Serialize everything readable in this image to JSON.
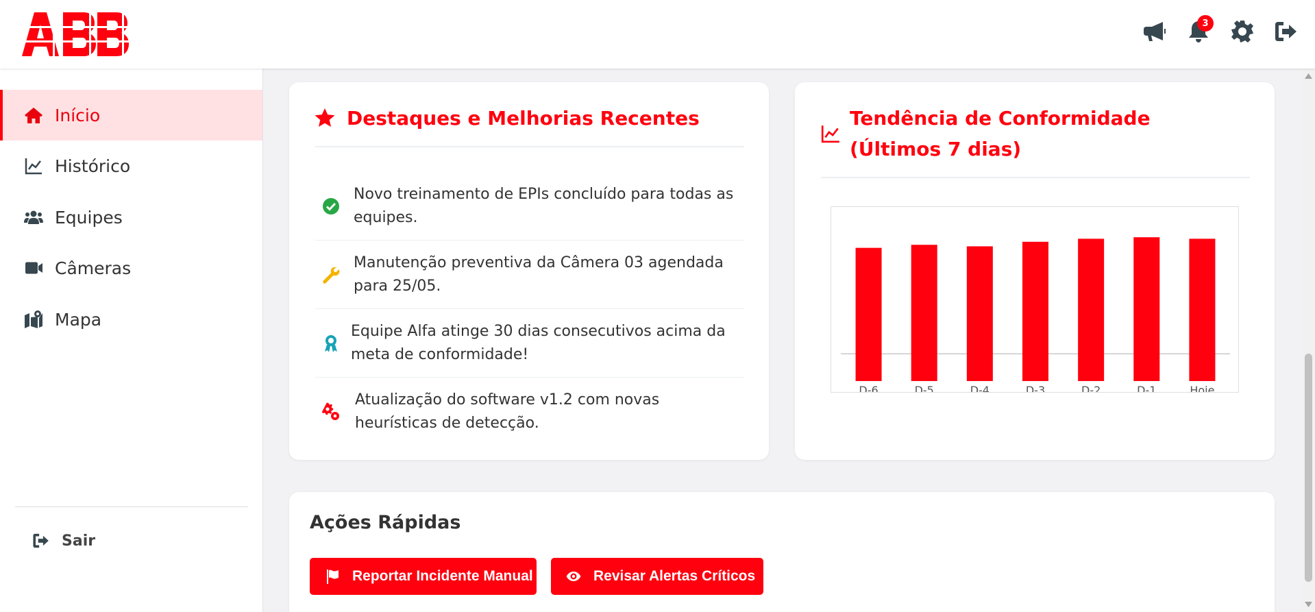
{
  "header": {
    "logo_text": "ABB",
    "notification_count": "3",
    "icons": [
      "megaphone-icon",
      "bell-icon",
      "gear-icon",
      "sign-out-icon"
    ]
  },
  "sidebar": {
    "items": [
      {
        "label": "Início",
        "icon": "home-icon",
        "active": true
      },
      {
        "label": "Histórico",
        "icon": "chart-line-icon",
        "active": false
      },
      {
        "label": "Equipes",
        "icon": "users-icon",
        "active": false
      },
      {
        "label": "Câmeras",
        "icon": "video-icon",
        "active": false
      },
      {
        "label": "Mapa",
        "icon": "map-icon",
        "active": false
      }
    ],
    "logout_label": "Sair"
  },
  "highlights": {
    "title": "Destaques e Melhorias Recentes",
    "items": [
      {
        "text": "Novo treinamento de EPIs concluído para todas as equipes.",
        "icon": "check-circle-icon"
      },
      {
        "text": "Manutenção preventiva da Câmera 03 agendada para 25/05.",
        "icon": "wrench-icon"
      },
      {
        "text": "Equipe Alfa atinge 30 dias consecutivos acima da meta de conformidade!",
        "icon": "award-icon"
      },
      {
        "text": "Atualização do software v1.2 com novas heurísticas de detecção.",
        "icon": "cogs-icon"
      }
    ]
  },
  "trend": {
    "title": "Tendência de Conformidade (Últimos 7 dias)"
  },
  "chart_data": {
    "type": "bar",
    "categories": [
      "D-6",
      "D-5",
      "D-4",
      "D-3",
      "D-2",
      "D-1",
      "Hoje"
    ],
    "values": [
      88,
      90,
      89,
      92,
      94,
      95,
      94
    ],
    "ylim": [
      0,
      115
    ],
    "reference_line": 18,
    "title": "",
    "xlabel": "",
    "ylabel": "",
    "grid": false,
    "color": "#ff000f"
  },
  "quick_actions": {
    "title": "Ações Rápidas",
    "buttons": [
      {
        "label": "Reportar Incidente Manual",
        "icon": "flag-icon"
      },
      {
        "label": "Revisar Alertas Críticos",
        "icon": "eye-icon"
      }
    ]
  },
  "colors": {
    "brand": "#ff000f",
    "active_bg": "#ffe1e3",
    "icon_gray": "#37474f",
    "success": "#28a745",
    "warning": "#f4b400",
    "info": "#17a2b8"
  }
}
